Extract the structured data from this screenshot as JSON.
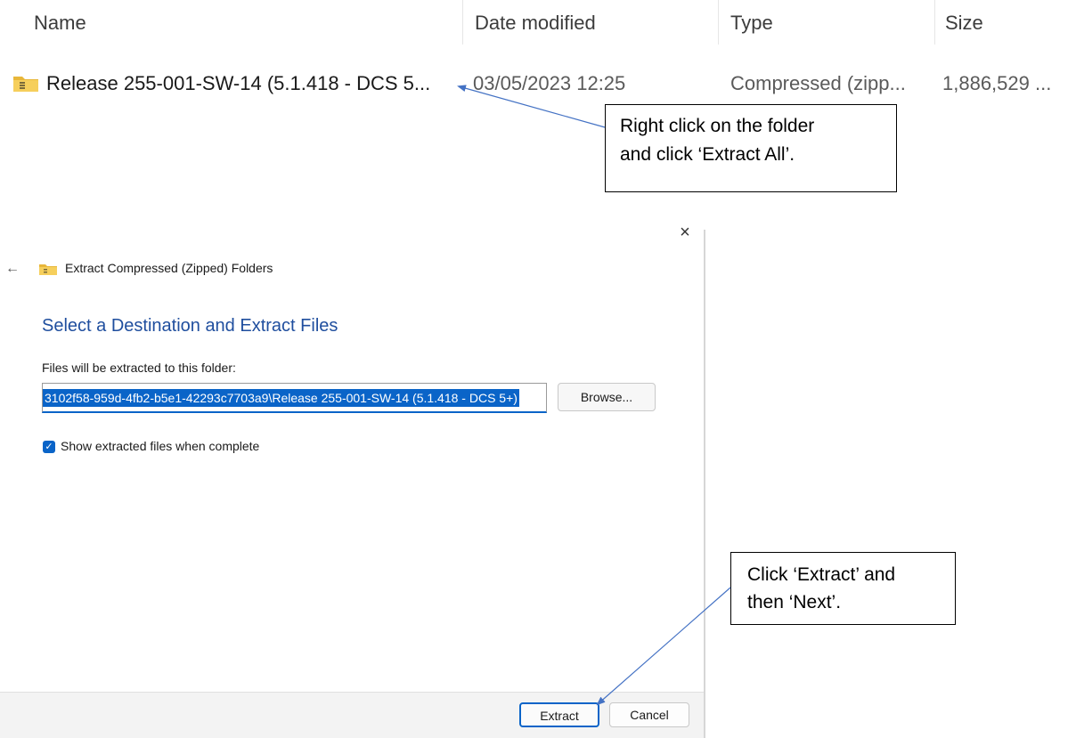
{
  "explorer": {
    "columns": {
      "name": "Name",
      "date_modified": "Date modified",
      "type": "Type",
      "size": "Size"
    },
    "file": {
      "icon": "zip-folder-icon",
      "name": "Release 255-001-SW-14 (5.1.418 - DCS 5...",
      "date_modified": "03/05/2023 12:25",
      "type": "Compressed (zipp...",
      "size": "1,886,529 ..."
    }
  },
  "callouts": {
    "extract_all": {
      "line1": "Right click on the folder",
      "line2": "and click ‘Extract All’."
    },
    "extract_next": {
      "line1": "Click ‘Extract’ and",
      "line2": "then ‘Next’."
    }
  },
  "dialog": {
    "close_glyph": "×",
    "back_glyph": "←",
    "title": "Extract Compressed (Zipped) Folders",
    "heading": "Select a Destination and Extract Files",
    "field_label": "Files will be extracted to this folder:",
    "path_value": "3102f58-959d-4fb2-b5e1-42293c7703a9\\Release 255-001-SW-14 (5.1.418 - DCS 5+)",
    "browse_label": "Browse...",
    "checkbox": {
      "checked": true,
      "label": "Show extracted files when complete"
    },
    "extract_label": "Extract",
    "cancel_label": "Cancel"
  },
  "colors": {
    "accent": "#0a64c8",
    "heading": "#1f4e9e",
    "arrow": "#4472c4"
  }
}
